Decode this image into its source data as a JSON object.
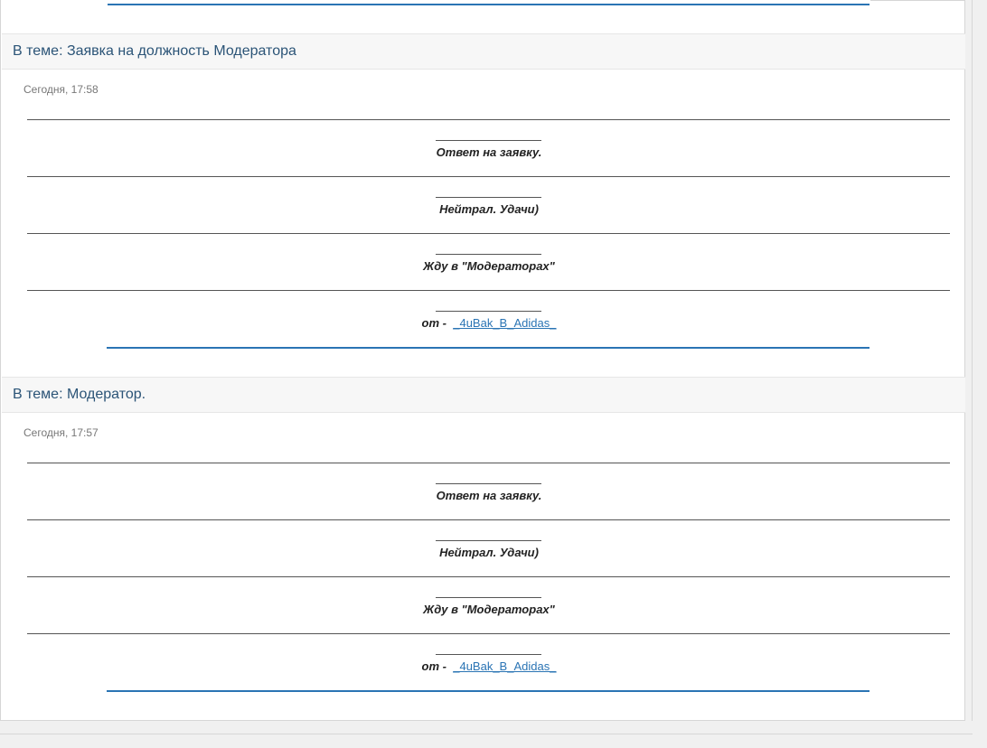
{
  "posts": [
    {
      "topic_label": "В теме: Заявка на должность Модератора",
      "date": "Сегодня, 17:58",
      "lines": [
        "Ответ на заявку.",
        "Нейтрал. Удачи)",
        "Жду в \"Модераторах\""
      ],
      "signature_prefix": "от -",
      "signature_link": "_4uBak_B_Adidas_"
    },
    {
      "topic_label": "В теме: Модератор.",
      "date": "Сегодня, 17:57",
      "lines": [
        "Ответ на заявку.",
        "Нейтрал. Удачи)",
        "Жду в \"Модераторах\""
      ],
      "signature_prefix": "от -",
      "signature_link": "_4uBak_B_Adidas_"
    }
  ],
  "colors": {
    "accent": "#2a74b4",
    "header_text": "#2b5477",
    "header_bg": "#f7f7f7"
  }
}
